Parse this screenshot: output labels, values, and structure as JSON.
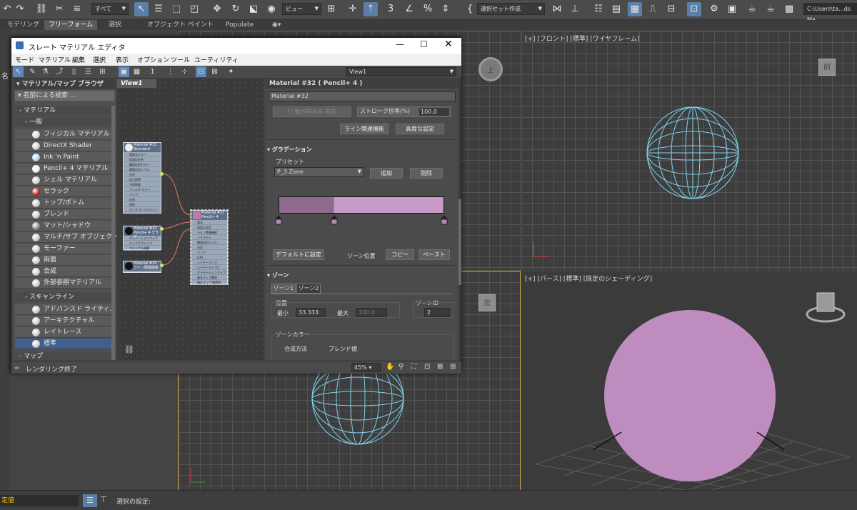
{
  "toolbar": {
    "selection_filter": "すべて",
    "view_ref": "ビュー",
    "named_set": "選択セット作成",
    "path": "C:\\Users\\ta...ds Ma"
  },
  "ribbon": {
    "tabs": [
      "モデリング",
      "フリーフォーム",
      "選択",
      "オブジェクト ペイント",
      "Populate"
    ]
  },
  "side_label": "名",
  "viewports": {
    "front_label": "[+] [フロント] [標準] [ワイヤフレーム]",
    "persp_label": "[+] [パース] [標準] [既定のシェーディング]",
    "top_cube": "上",
    "front_cube": "前",
    "left_cube": "左"
  },
  "slate": {
    "title": "スレート マテリアル エディタ",
    "menu": [
      "モード",
      "マテリアル",
      "編集",
      "選択",
      "表示",
      "オプション",
      "ツール",
      "ユーティリティ"
    ],
    "view_dropdown": "View1",
    "view_tab": "View1",
    "browser": {
      "title": "マテリアル/マップ ブラウザ",
      "search": "名前による検索 ...",
      "cat_material": "- マテリアル",
      "cat_general": "- 一般",
      "cat_scanline": "- スキャンライン",
      "cat_maps": "- マップ",
      "general_items": [
        {
          "label": "フィジカル マテリアル",
          "color": "#d9d9d9"
        },
        {
          "label": "DirectX Shader",
          "color": "#cfcfcf"
        },
        {
          "label": "Ink 'n Paint",
          "color": "#a9d6f0"
        },
        {
          "label": "Pencil+ 4 マテリアル",
          "color": "#eeeeee"
        },
        {
          "label": "シェル マテリアル",
          "color": "#d0d0d0"
        },
        {
          "label": "セラック",
          "color": "#c0201e"
        },
        {
          "label": "トップ/ボトム",
          "color": "#cfcfcf"
        },
        {
          "label": "ブレンド",
          "color": "#cfcfcf"
        },
        {
          "label": "マット/シャドウ",
          "color": "#8a8a8a"
        },
        {
          "label": "マルチ/サブ オブジェクト",
          "color": "#cfcfcf"
        },
        {
          "label": "モーファー",
          "color": "#cfcfcf"
        },
        {
          "label": "両面",
          "color": "#cfcfcf"
        },
        {
          "label": "合成",
          "color": "#cfcfcf"
        },
        {
          "label": "外部参照マテリアル",
          "color": "#cfcfcf"
        }
      ],
      "scanline_items": [
        {
          "label": "アドバンスド ライティ...",
          "color": "#cfcfcf"
        },
        {
          "label": "アーキテクチャル",
          "color": "#cfcfcf"
        },
        {
          "label": "レイトレース",
          "color": "#cfcfcf"
        },
        {
          "label": "標準",
          "color": "#cfcfcf"
        }
      ]
    },
    "nodes": {
      "n1_title": "Material #31",
      "n1_sub": "Standard",
      "n1_rows": [
        "環境光カラー",
        "拡散反射色",
        "鏡面反射カラー",
        "鏡面反射レベル",
        "光沢",
        "自己照明",
        "不透明度",
        "フィルタ カラー",
        "バンプ",
        "反射",
        "屈折",
        "ディスプレイスメント"
      ],
      "n2_title": "Material #33",
      "n2_sub": "Pencil+ 4 グラデ",
      "n2_rows": [
        "グラデーションマップ",
        "シャドウブレンド",
        "マテリアル連動"
      ],
      "n3_title": "Material #34",
      "n3_sub": "ライン関連機能",
      "n4_title": "Material #32",
      "n4_sub": "Pencil+ 4",
      "n4_rows": [
        "基本",
        "高度な設定",
        "ライン関連機能",
        "ハイライト",
        "鏡面反射レベル",
        "光沢",
        "バンプ",
        "反射",
        "レイヤーマップ",
        "レイヤーマップ2",
        "グラデーションマップ",
        "基本マップ範囲",
        "基本マップ 範囲色"
      ]
    },
    "params": {
      "header": "Material #32 ( Pencil+ 4 )",
      "name": "Material #32",
      "only_active": "動作時のみ 有効",
      "stroke_label": "ストローク倍率(%)",
      "stroke_value": "100.0",
      "line_func": "ライン関連機能",
      "advanced": "高度な設定",
      "gradation": "グラデーション",
      "preset_label": "プリセット",
      "preset_value": "P_3 Zone",
      "add": "追加",
      "delete": "削除",
      "default_btn": "デフォルトに設定",
      "zone_pos": "ゾーン位置",
      "copy": "コピー",
      "paste": "ペースト",
      "zone_section": "ゾーン",
      "zone_tab1": "ゾーン1",
      "zone_tab2": "ゾーン2",
      "position_label": "位置",
      "min_label": "最小",
      "min_value": "33.333",
      "max_label": "最大",
      "max_value": "100.0",
      "zone_id_label": "ゾーンID",
      "zone_id_value": "2",
      "zone_color": "ゾーンカラー",
      "blend_mode": "合成方法",
      "blend_value": "ブレンド値",
      "gradient_colors": [
        "#8e6a8e",
        "#c79ac7"
      ]
    },
    "status": "レンダリング終了",
    "zoom": "45%"
  },
  "bottom": {
    "left_text": "定値",
    "selection_label": "選択の設定:"
  },
  "colors": {
    "sphere_fill": "#bf8cbf",
    "wire": "#7ed0ec"
  }
}
